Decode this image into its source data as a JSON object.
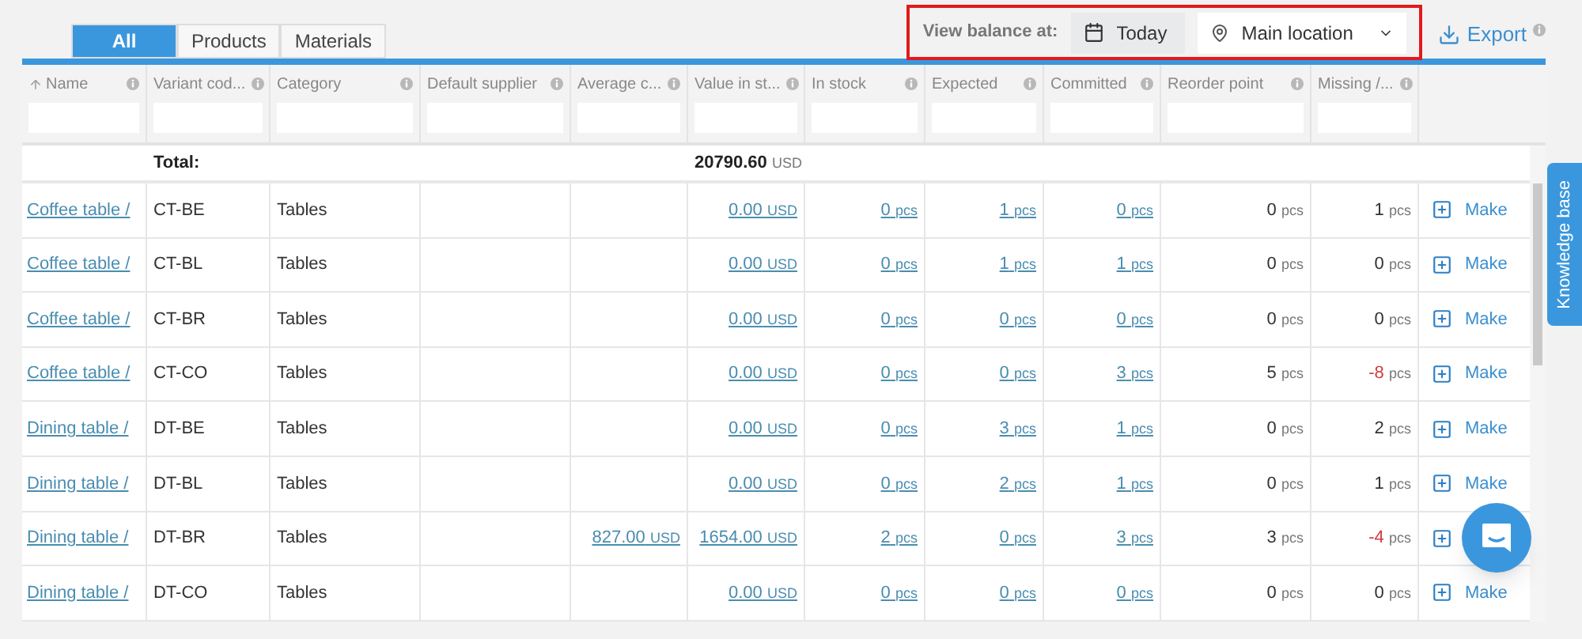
{
  "tabs": [
    {
      "label": "All",
      "selected": true
    },
    {
      "label": "Products",
      "selected": false
    },
    {
      "label": "Materials",
      "selected": false
    }
  ],
  "balance": {
    "label": "View balance at:",
    "date": "Today",
    "location": "Main location"
  },
  "export": {
    "label": "Export"
  },
  "columns": [
    {
      "label": "Name",
      "sorted": true
    },
    {
      "label": "Variant cod...",
      "sorted": false
    },
    {
      "label": "Category",
      "sorted": false
    },
    {
      "label": "Default supplier",
      "sorted": false
    },
    {
      "label": "Average c...",
      "sorted": false
    },
    {
      "label": "Value in st...",
      "sorted": false
    },
    {
      "label": "In stock",
      "sorted": false
    },
    {
      "label": "Expected",
      "sorted": false
    },
    {
      "label": "Committed",
      "sorted": false
    },
    {
      "label": "Reorder point",
      "sorted": false
    },
    {
      "label": "Missing /...",
      "sorted": false
    }
  ],
  "total": {
    "label": "Total:",
    "value": "20790.60",
    "unit": "USD"
  },
  "rows": [
    {
      "name": "Coffee table /",
      "code": "CT-BE",
      "category": "Tables",
      "avg": null,
      "value": {
        "n": "0.00",
        "u": "USD"
      },
      "in_stock": {
        "n": "0",
        "u": "pcs"
      },
      "expected": {
        "n": "1",
        "u": "pcs"
      },
      "committed": {
        "n": "0",
        "u": "pcs"
      },
      "reorder": {
        "n": "0",
        "u": "pcs"
      },
      "missing": {
        "n": "1",
        "u": "pcs"
      },
      "negative": false,
      "action": "Make"
    },
    {
      "name": "Coffee table /",
      "code": "CT-BL",
      "category": "Tables",
      "avg": null,
      "value": {
        "n": "0.00",
        "u": "USD"
      },
      "in_stock": {
        "n": "0",
        "u": "pcs"
      },
      "expected": {
        "n": "1",
        "u": "pcs"
      },
      "committed": {
        "n": "1",
        "u": "pcs"
      },
      "reorder": {
        "n": "0",
        "u": "pcs"
      },
      "missing": {
        "n": "0",
        "u": "pcs"
      },
      "negative": false,
      "action": "Make"
    },
    {
      "name": "Coffee table /",
      "code": "CT-BR",
      "category": "Tables",
      "avg": null,
      "value": {
        "n": "0.00",
        "u": "USD"
      },
      "in_stock": {
        "n": "0",
        "u": "pcs"
      },
      "expected": {
        "n": "0",
        "u": "pcs"
      },
      "committed": {
        "n": "0",
        "u": "pcs"
      },
      "reorder": {
        "n": "0",
        "u": "pcs"
      },
      "missing": {
        "n": "0",
        "u": "pcs"
      },
      "negative": false,
      "action": "Make"
    },
    {
      "name": "Coffee table /",
      "code": "CT-CO",
      "category": "Tables",
      "avg": null,
      "value": {
        "n": "0.00",
        "u": "USD"
      },
      "in_stock": {
        "n": "0",
        "u": "pcs"
      },
      "expected": {
        "n": "0",
        "u": "pcs"
      },
      "committed": {
        "n": "3",
        "u": "pcs"
      },
      "reorder": {
        "n": "5",
        "u": "pcs"
      },
      "missing": {
        "n": "-8",
        "u": "pcs"
      },
      "negative": true,
      "action": "Make"
    },
    {
      "name": "Dining table /",
      "code": "DT-BE",
      "category": "Tables",
      "avg": null,
      "value": {
        "n": "0.00",
        "u": "USD"
      },
      "in_stock": {
        "n": "0",
        "u": "pcs"
      },
      "expected": {
        "n": "3",
        "u": "pcs"
      },
      "committed": {
        "n": "1",
        "u": "pcs"
      },
      "reorder": {
        "n": "0",
        "u": "pcs"
      },
      "missing": {
        "n": "2",
        "u": "pcs"
      },
      "negative": false,
      "action": "Make"
    },
    {
      "name": "Dining table /",
      "code": "DT-BL",
      "category": "Tables",
      "avg": null,
      "value": {
        "n": "0.00",
        "u": "USD"
      },
      "in_stock": {
        "n": "0",
        "u": "pcs"
      },
      "expected": {
        "n": "2",
        "u": "pcs"
      },
      "committed": {
        "n": "1",
        "u": "pcs"
      },
      "reorder": {
        "n": "0",
        "u": "pcs"
      },
      "missing": {
        "n": "1",
        "u": "pcs"
      },
      "negative": false,
      "action": "Make"
    },
    {
      "name": "Dining table /",
      "code": "DT-BR",
      "category": "Tables",
      "avg": {
        "n": "827.00",
        "u": "USD"
      },
      "value": {
        "n": "1654.00",
        "u": "USD"
      },
      "in_stock": {
        "n": "2",
        "u": "pcs"
      },
      "expected": {
        "n": "0",
        "u": "pcs"
      },
      "committed": {
        "n": "3",
        "u": "pcs"
      },
      "reorder": {
        "n": "3",
        "u": "pcs"
      },
      "missing": {
        "n": "-4",
        "u": "pcs"
      },
      "negative": true,
      "action": null
    },
    {
      "name": "Dining table /",
      "code": "DT-CO",
      "category": "Tables",
      "avg": null,
      "value": {
        "n": "0.00",
        "u": "USD"
      },
      "in_stock": {
        "n": "0",
        "u": "pcs"
      },
      "expected": {
        "n": "0",
        "u": "pcs"
      },
      "committed": {
        "n": "0",
        "u": "pcs"
      },
      "reorder": {
        "n": "0",
        "u": "pcs"
      },
      "missing": {
        "n": "0",
        "u": "pcs"
      },
      "negative": false,
      "action": "Make"
    }
  ],
  "knowledge_base": "Knowledge base"
}
